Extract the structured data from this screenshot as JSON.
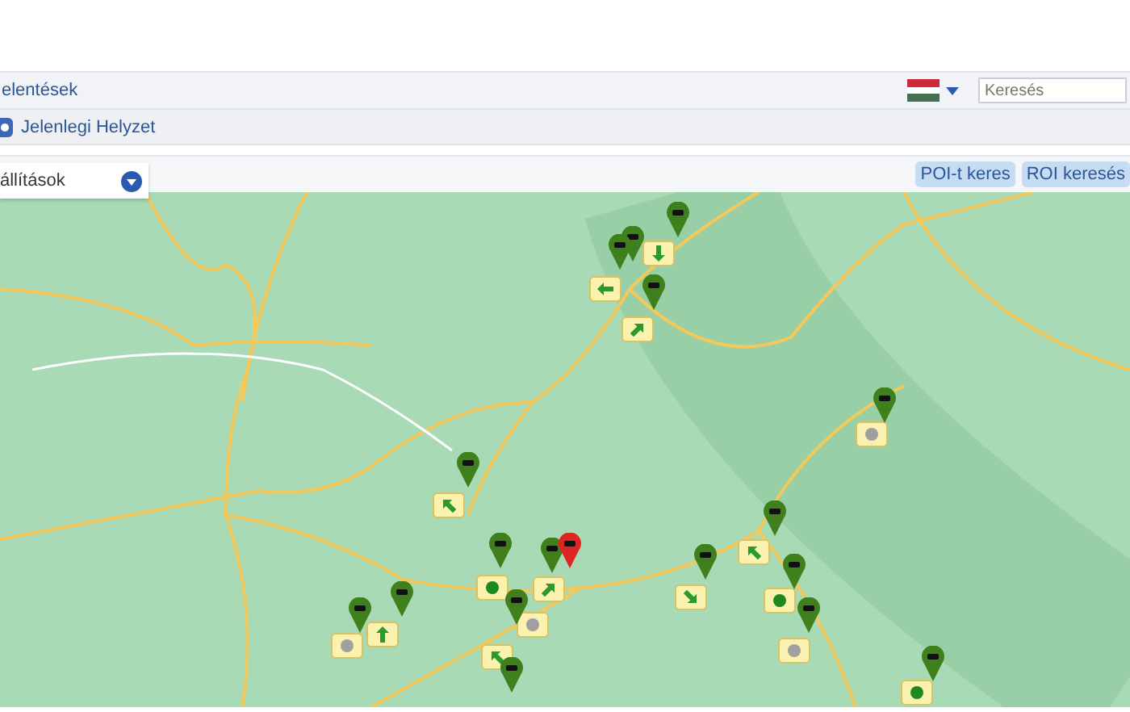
{
  "nav": {
    "menu_item": "elentések",
    "search": {
      "placeholder": "Keresés"
    }
  },
  "breadcrumb": {
    "label": "Jelenlegi Helyzet"
  },
  "toolbar": {
    "settings_dropdown": "állítások",
    "buttons": [
      "POI-t keres",
      "ROI keresés"
    ]
  },
  "map": {
    "vehicles": [
      {
        "color": "#3f7f1c"
      },
      {
        "color": "#3f7f1c"
      },
      {
        "color": "#3f7f1c"
      },
      {
        "color": "#3f7f1c"
      },
      {
        "color": "#3f7f1c"
      },
      {
        "color": "#3f7f1c"
      },
      {
        "color": "#3f7f1c"
      },
      {
        "color": "#3f7f1c"
      },
      {
        "color": "#e02424"
      },
      {
        "color": "#3f7f1c"
      },
      {
        "color": "#3f7f1c"
      },
      {
        "color": "#3f7f1c"
      },
      {
        "color": "#3f7f1c"
      },
      {
        "color": "#3f7f1c"
      },
      {
        "color": "#3f7f1c"
      },
      {
        "color": "#3f7f1c"
      },
      {
        "color": "#3f7f1c"
      },
      {
        "color": "#3f7f1c"
      }
    ],
    "status_markers": [
      {
        "kind": "down"
      },
      {
        "kind": "left"
      },
      {
        "kind": "up-right"
      },
      {
        "kind": "dot",
        "color": "#a0a0a0"
      },
      {
        "kind": "up-left"
      },
      {
        "kind": "dot",
        "color": "#1e8a1e"
      },
      {
        "kind": "up-right"
      },
      {
        "kind": "dot",
        "color": "#a0a0a0"
      },
      {
        "kind": "dot",
        "color": "#a0a0a0"
      },
      {
        "kind": "up"
      },
      {
        "kind": "up-left"
      },
      {
        "kind": "down-right"
      },
      {
        "kind": "up-left"
      },
      {
        "kind": "dot",
        "color": "#1e8a1e"
      },
      {
        "kind": "dot",
        "color": "#a0a0a0"
      },
      {
        "kind": "dot",
        "color": "#1e8a1e"
      }
    ]
  }
}
